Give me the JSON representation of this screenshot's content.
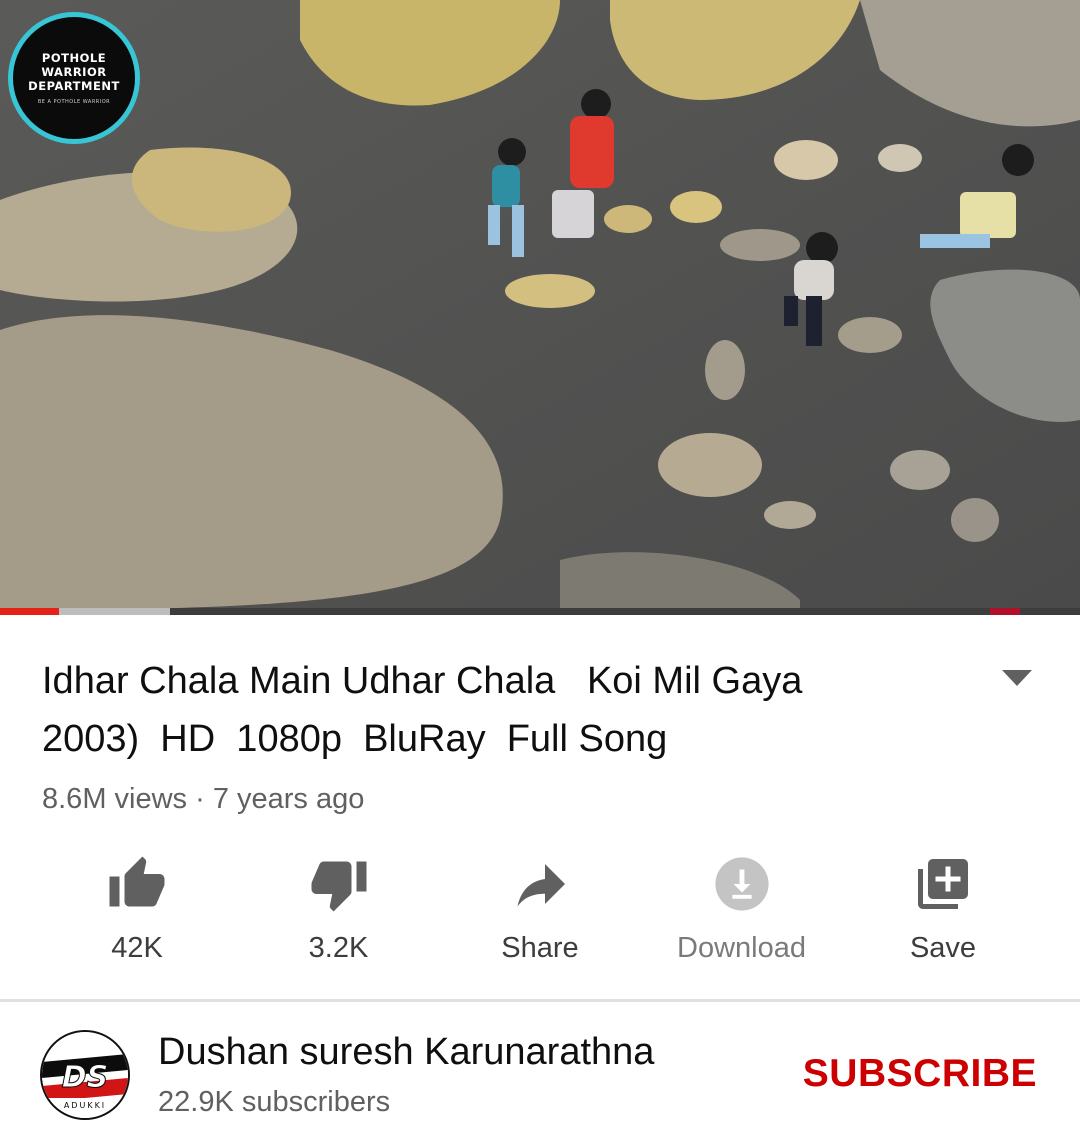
{
  "video": {
    "badge_text": "POTHOLE\nWARRIOR\nDEPARTMENT",
    "badge_subtext": "BE A POTHOLE WARRIOR",
    "progress_fraction": 0.055,
    "buffer_fraction": 0.157
  },
  "title": "Idhar Chala Main Udhar Chala   Koi Mil Gaya\n2003)  HD  1080p  BluRay  Full Song",
  "meta": "8.6M views · 7 years ago",
  "actions": [
    {
      "icon": "thumbs-up-icon",
      "label": "42K"
    },
    {
      "icon": "thumbs-down-icon",
      "label": "3.2K"
    },
    {
      "icon": "share-icon",
      "label": "Share"
    },
    {
      "icon": "download-icon",
      "label": "Download"
    },
    {
      "icon": "add-to-playlist-icon",
      "label": "Save"
    }
  ],
  "channel": {
    "name": "Dushan suresh Karunarathna",
    "subscribers": "22.9K subscribers",
    "avatar_text": "DS",
    "avatar_subtext": "ADUKKI"
  },
  "subscribe_label": "SUBSCRIBE",
  "colors": {
    "accent_red": "#cc0000",
    "progress_red": "#e62117",
    "badge_ring": "#38c6d6"
  }
}
